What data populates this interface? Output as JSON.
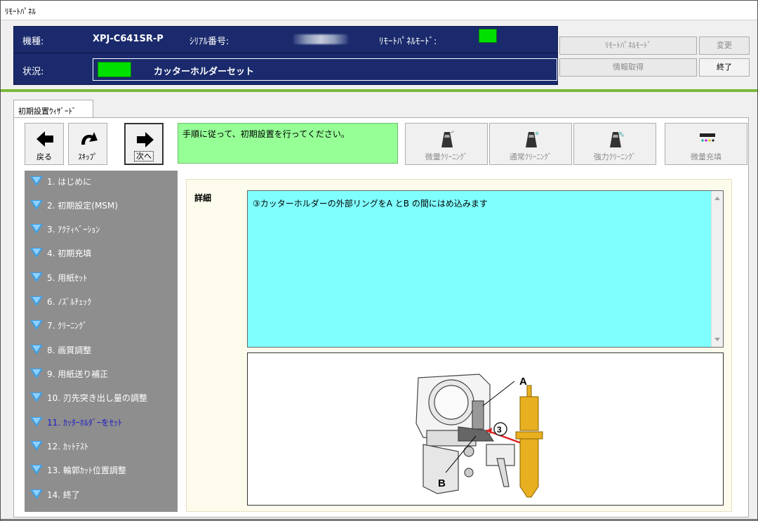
{
  "window": {
    "title": "ﾘﾓｰﾄﾊﾟﾈﾙ"
  },
  "header": {
    "model_label": "機種:",
    "model_value": "XPJ-C641SR-P",
    "serial_label": "ｼﾘｱﾙ番号:",
    "remote_mode_label": "ﾘﾓｰﾄﾊﾟﾈﾙﾓｰﾄﾞ:",
    "status_label": "状況:",
    "status_value": "カッターホルダーセット",
    "indicator_color": "#00e000"
  },
  "buttons": {
    "remote_panel_mode": "ﾘﾓｰﾄﾊﾟﾈﾙﾓｰﾄﾞ",
    "change": "変更",
    "get_info": "情報取得",
    "exit": "終了"
  },
  "tab": {
    "label": "初期設置ｳｨｻﾞｰﾄﾞ"
  },
  "nav": {
    "back": "戻る",
    "skip": "ｽｷｯﾌﾟ",
    "next": "次へ"
  },
  "instruction": "手順に従って、初期設置を行ってください。",
  "cleaning": {
    "light": "微量ｸﾘｰﾆﾝｸﾞ",
    "normal": "通常ｸﾘｰﾆﾝｸﾞ",
    "strong": "強力ｸﾘｰﾆﾝｸﾞ",
    "fill": "微量充填"
  },
  "steps": [
    "1. はじめに",
    "2. 初期設定(MSM)",
    "3. ｱｸﾃｨﾍﾞｰｼｮﾝ",
    "4. 初期充填",
    "5. 用紙ｾｯﾄ",
    "6. ﾉｽﾞﾙﾁｪｯｸ",
    "7. ｸﾘｰﾆﾝｸﾞ",
    "8. 画質調整",
    "9. 用紙送り補正",
    "10. 刃先突き出し量の調整",
    "11. ｶｯﾀｰﾎﾙﾀﾞｰをｾｯﾄ",
    "12. ｶｯﾄﾃｽﾄ",
    "13. 輪郭ｶｯﾄ位置調整",
    "14. 終了"
  ],
  "current_step_index": 10,
  "detail": {
    "label": "詳細",
    "text": "③カッターホルダーの外部リングをA とB の間にはめ込みます"
  },
  "figure": {
    "label_a": "A",
    "label_b": "B",
    "label_step": "3"
  }
}
